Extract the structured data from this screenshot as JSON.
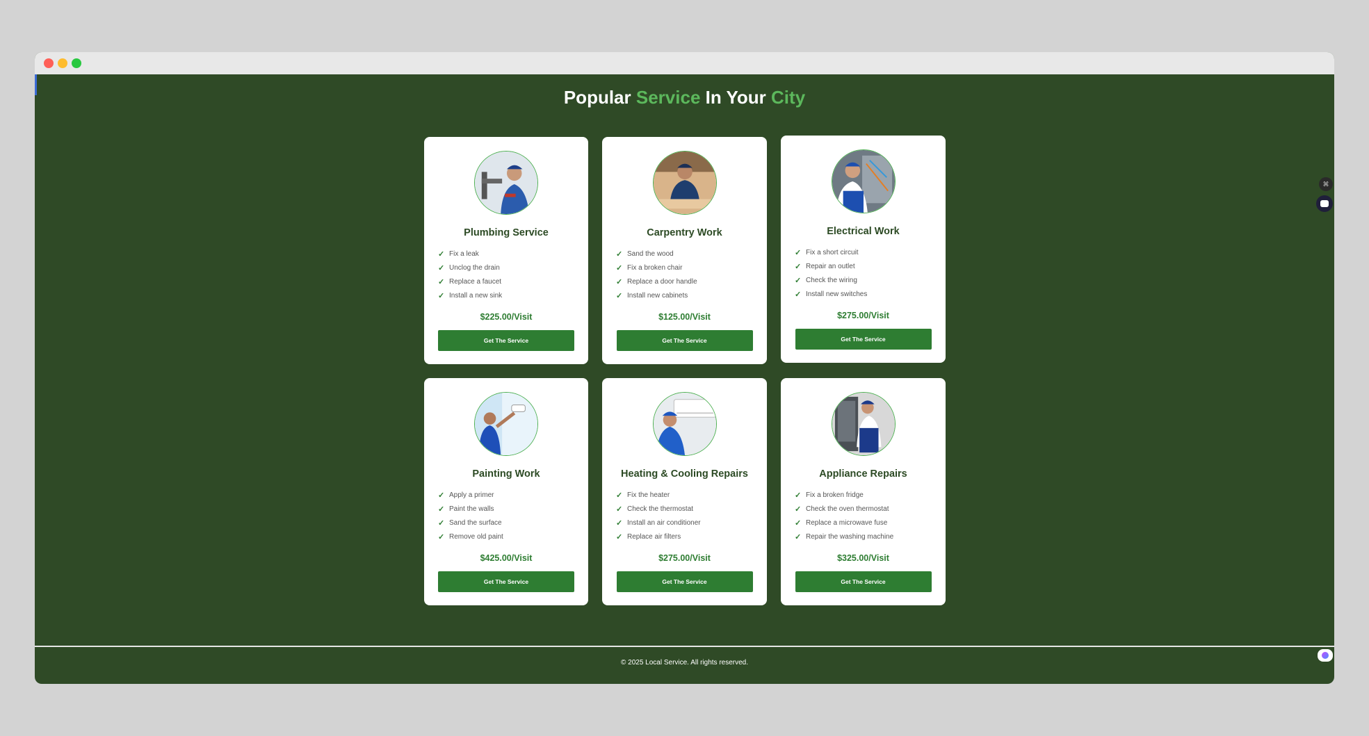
{
  "heading": {
    "part1": "Popular",
    "part2": "Service",
    "part3": "In Your",
    "part4": "City"
  },
  "cards": [
    {
      "title": "Plumbing Service",
      "features": [
        "Fix a leak",
        "Unclog the drain",
        "Replace a faucet",
        "Install a new sink"
      ],
      "price": "$225.00/Visit",
      "button": "Get The Service",
      "icon": "plumber-icon"
    },
    {
      "title": "Carpentry Work",
      "features": [
        "Sand the wood",
        "Fix a broken chair",
        "Replace a door handle",
        "Install new cabinets"
      ],
      "price": "$125.00/Visit",
      "button": "Get The Service",
      "icon": "carpenter-icon"
    },
    {
      "title": "Electrical Work",
      "features": [
        "Fix a short circuit",
        "Repair an outlet",
        "Check the wiring",
        "Install new switches"
      ],
      "price": "$275.00/Visit",
      "button": "Get The Service",
      "icon": "electrician-icon"
    },
    {
      "title": "Painting Work",
      "features": [
        "Apply a primer",
        "Paint the walls",
        "Sand the surface",
        "Remove old paint"
      ],
      "price": "$425.00/Visit",
      "button": "Get The Service",
      "icon": "painter-icon"
    },
    {
      "title": "Heating & Cooling Repairs",
      "features": [
        "Fix the heater",
        "Check the thermostat",
        "Install an air conditioner",
        "Replace air filters"
      ],
      "price": "$275.00/Visit",
      "button": "Get The Service",
      "icon": "hvac-technician-icon"
    },
    {
      "title": "Appliance Repairs",
      "features": [
        "Fix a broken fridge",
        "Check the oven thermostat",
        "Replace a microwave fuse",
        "Repair the washing machine"
      ],
      "price": "$325.00/Visit",
      "button": "Get The Service",
      "icon": "appliance-technician-icon"
    }
  ],
  "footer": {
    "text": "© 2025 Local Service. All rights reserved."
  },
  "colors": {
    "background": "#2f4a26",
    "accent": "#5cb85c",
    "button": "#2e7d32",
    "card_title": "#2c4a24"
  }
}
